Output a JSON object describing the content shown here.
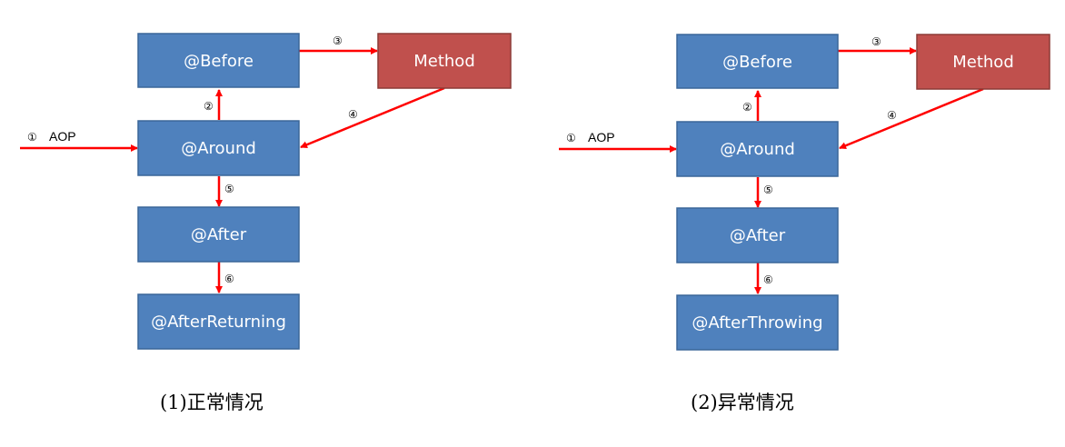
{
  "colors": {
    "box_blue": "#4F81BD",
    "box_blue_stroke": "#3A6699",
    "box_red": "#C0504D",
    "box_red_stroke": "#8C3A36",
    "arrow": "#FF0000"
  },
  "diagrams": [
    {
      "boxes": {
        "before": "@Before",
        "method": "Method",
        "around": "@Around",
        "after": "@After",
        "final": "@AfterReturning"
      },
      "labels": {
        "n1": "①",
        "aop": "AOP",
        "n2": "②",
        "n3": "③",
        "n4": "④",
        "n5": "⑤",
        "n6": "⑥"
      },
      "caption": "(1)正常情况"
    },
    {
      "boxes": {
        "before": "@Before",
        "method": "Method",
        "around": "@Around",
        "after": "@After",
        "final": "@AfterThrowing"
      },
      "labels": {
        "n1": "①",
        "aop": "AOP",
        "n2": "②",
        "n3": "③",
        "n4": "④",
        "n5": "⑤",
        "n6": "⑥"
      },
      "caption": "(2)异常情况"
    }
  ]
}
